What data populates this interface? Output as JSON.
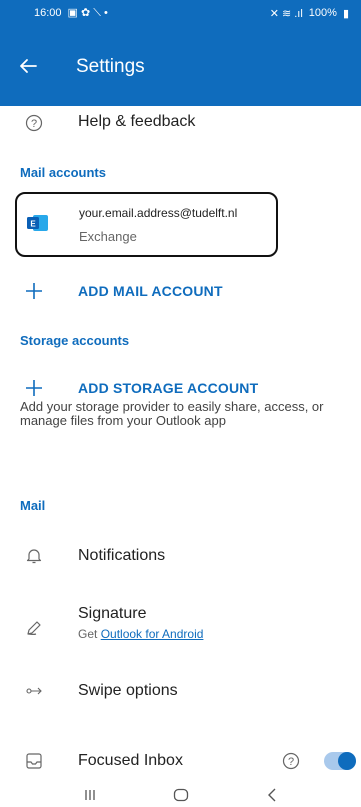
{
  "status_bar": {
    "time": "16:00",
    "battery": "100%"
  },
  "header": {
    "title": "Settings"
  },
  "help_row": {
    "label": "Help & feedback"
  },
  "mail_accounts": {
    "section_title": "Mail accounts",
    "account": {
      "email": "your.email.address@tudelft.nl",
      "type": "Exchange"
    },
    "add_label": "ADD MAIL ACCOUNT"
  },
  "storage_accounts": {
    "section_title": "Storage accounts",
    "add_label": "ADD STORAGE ACCOUNT",
    "description": "Add your storage provider to easily share, access, or manage files from your Outlook app"
  },
  "mail": {
    "section_title": "Mail",
    "notifications_label": "Notifications",
    "signature_label": "Signature",
    "signature_sub_prefix": "Get ",
    "signature_sub_link": "Outlook for Android",
    "swipe_label": "Swipe options",
    "focused_label": "Focused Inbox",
    "focused_enabled": true
  },
  "colors": {
    "accent": "#0f6cbd"
  },
  "icons": [
    "back-arrow-icon",
    "help-icon",
    "exchange-icon",
    "plus-icon",
    "bell-icon",
    "pen-icon",
    "swipe-icon",
    "inbox-icon"
  ]
}
